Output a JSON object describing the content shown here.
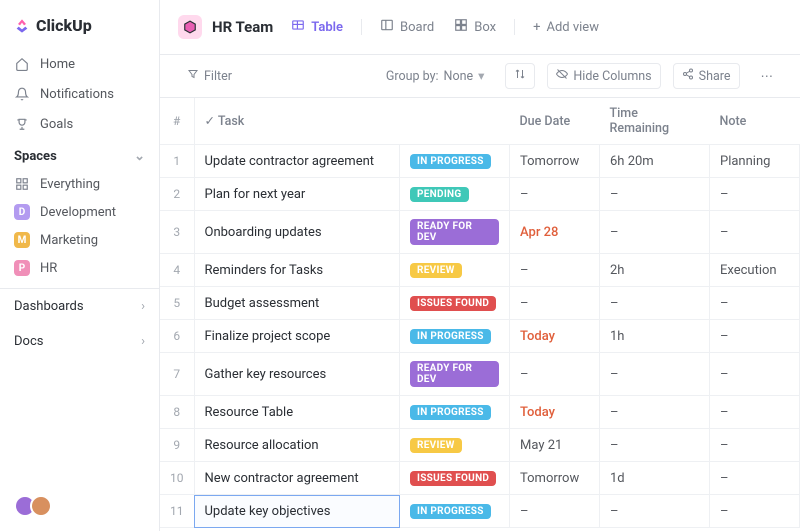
{
  "brand": "ClickUp",
  "nav": {
    "home": "Home",
    "notifications": "Notifications",
    "goals": "Goals"
  },
  "spaces": {
    "header": "Spaces",
    "everything": "Everything",
    "items": [
      {
        "badge": "D",
        "bg": "#b39bf0",
        "label": "Development"
      },
      {
        "badge": "M",
        "bg": "#f0b84a",
        "label": "Marketing"
      },
      {
        "badge": "P",
        "bg": "#f08fb8",
        "label": "HR"
      }
    ]
  },
  "bottom": {
    "dashboards": "Dashboards",
    "docs": "Docs"
  },
  "header": {
    "title": "HR Team",
    "views": {
      "table": "Table",
      "board": "Board",
      "box": "Box",
      "add": "Add view"
    }
  },
  "toolbar": {
    "filter": "Filter",
    "groupby_label": "Group by:",
    "groupby_value": "None",
    "hide_columns": "Hide Columns",
    "share": "Share"
  },
  "columns": {
    "num": "#",
    "task": "Task",
    "due": "Due Date",
    "time": "Time Remaining",
    "note": "Note"
  },
  "status_labels": {
    "in-progress": "IN PROGRESS",
    "pending": "PENDING",
    "ready-for-dev": "READY FOR DEV",
    "review": "REVIEW",
    "issues-found": "ISSUES FOUND"
  },
  "rows": [
    {
      "n": "1",
      "task": "Update contractor agreement",
      "status": "in-progress",
      "due": "Tomorrow",
      "due_red": false,
      "time": "6h 20m",
      "note": "Planning"
    },
    {
      "n": "2",
      "task": "Plan for next year",
      "status": "pending",
      "due": "–",
      "due_red": false,
      "time": "–",
      "note": "–"
    },
    {
      "n": "3",
      "task": "Onboarding updates",
      "status": "ready-for-dev",
      "due": "Apr 28",
      "due_red": true,
      "time": "–",
      "note": "–"
    },
    {
      "n": "4",
      "task": "Reminders for Tasks",
      "status": "review",
      "due": "–",
      "due_red": false,
      "time": "2h",
      "note": "Execution"
    },
    {
      "n": "5",
      "task": "Budget assessment",
      "status": "issues-found",
      "due": "–",
      "due_red": false,
      "time": "–",
      "note": "–"
    },
    {
      "n": "6",
      "task": "Finalize project scope",
      "status": "in-progress",
      "due": "Today",
      "due_red": true,
      "time": "1h",
      "note": "–"
    },
    {
      "n": "7",
      "task": "Gather key resources",
      "status": "ready-for-dev",
      "due": "–",
      "due_red": false,
      "time": "–",
      "note": "–"
    },
    {
      "n": "8",
      "task": "Resource Table",
      "status": "in-progress",
      "due": "Today",
      "due_red": true,
      "time": "–",
      "note": "–"
    },
    {
      "n": "9",
      "task": "Resource allocation",
      "status": "review",
      "due": "May 21",
      "due_red": false,
      "time": "–",
      "note": "–"
    },
    {
      "n": "10",
      "task": "New contractor agreement",
      "status": "issues-found",
      "due": "Tomorrow",
      "due_red": false,
      "time": "1d",
      "note": "–"
    },
    {
      "n": "11",
      "task": "Update key objectives",
      "status": "in-progress",
      "due": "–",
      "due_red": false,
      "time": "–",
      "note": "–",
      "editing": true
    }
  ]
}
